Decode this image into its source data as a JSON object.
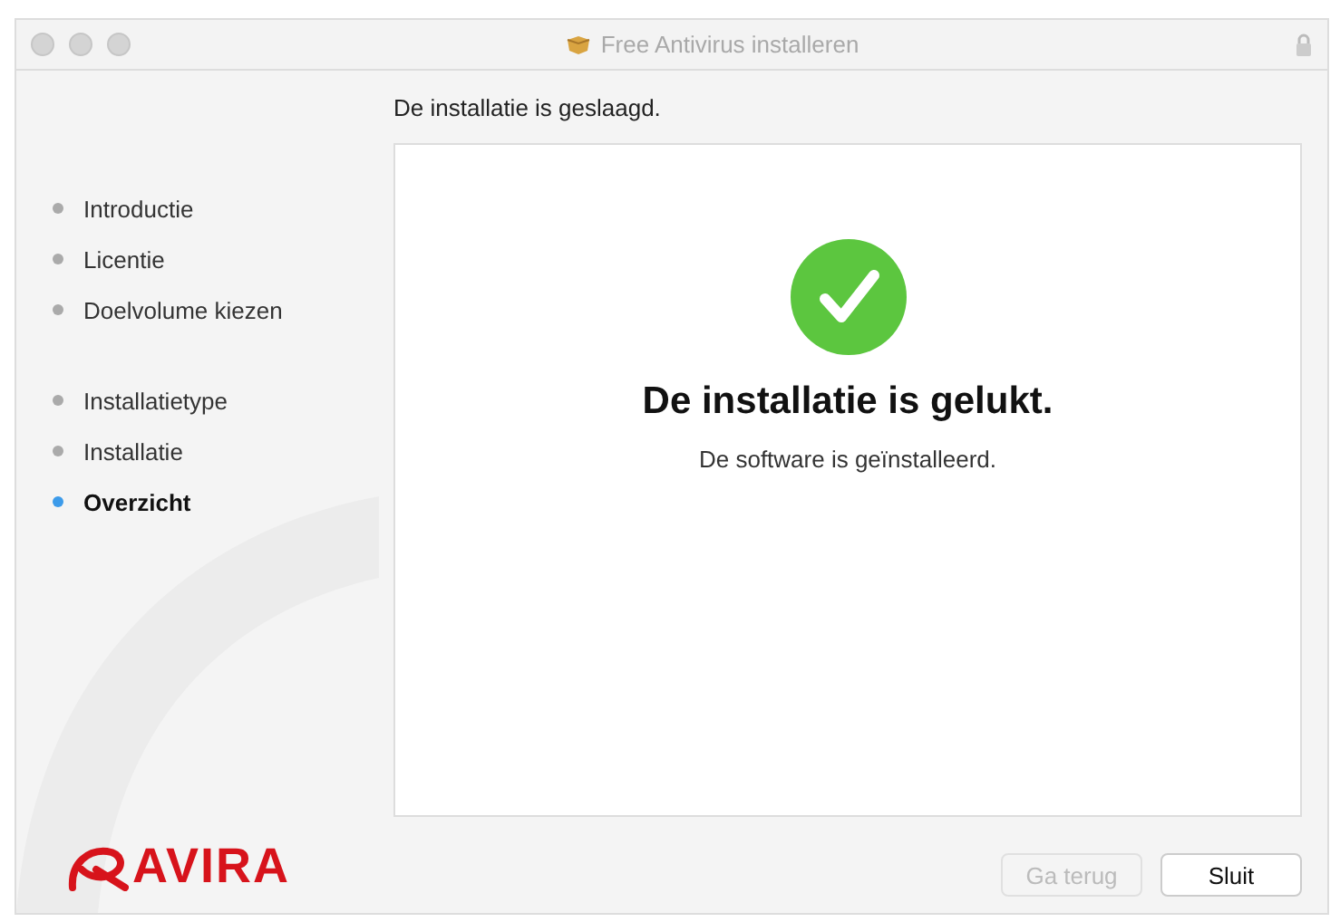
{
  "window": {
    "title": "Free Antivirus installeren"
  },
  "heading": "De installatie is geslaagd.",
  "step_groups": [
    {
      "steps": [
        {
          "label": "Introductie",
          "selected": false
        },
        {
          "label": "Licentie",
          "selected": false
        },
        {
          "label": "Doelvolume kiezen",
          "selected": false
        }
      ]
    },
    {
      "steps": [
        {
          "label": "Installatietype",
          "selected": false
        },
        {
          "label": "Installatie",
          "selected": false
        },
        {
          "label": "Overzicht",
          "selected": true
        }
      ]
    }
  ],
  "result": {
    "title": "De installatie is gelukt.",
    "message": "De software is geïnstalleerd."
  },
  "logo": {
    "text": "AVIRA"
  },
  "buttons": [
    {
      "label": "Ga terug",
      "disabled": true
    },
    {
      "label": "Sluit",
      "disabled": false
    }
  ]
}
